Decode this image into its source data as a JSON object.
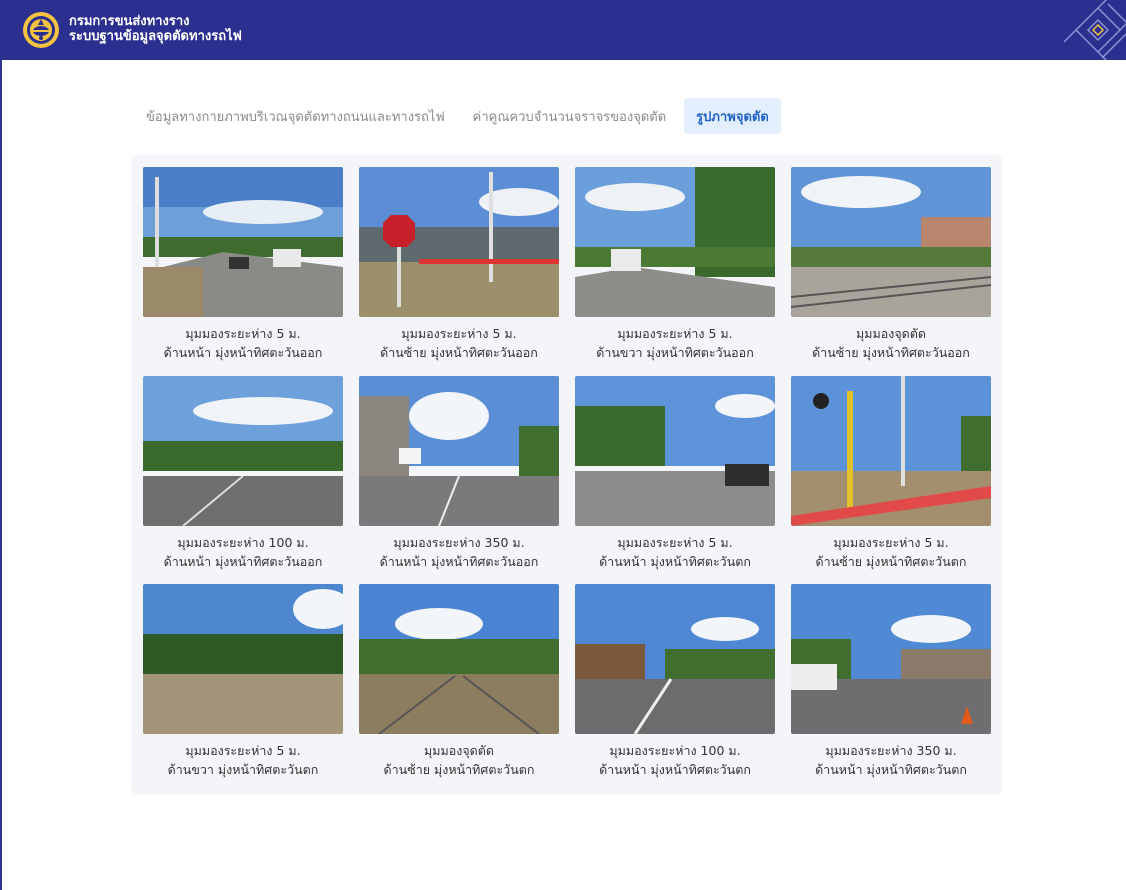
{
  "header": {
    "org_name": "กรมการขนส่งทางราง",
    "system_name": "ระบบฐานข้อมูลจุดตัดทางรถไฟ"
  },
  "tabs": [
    {
      "label": "ข้อมูลทางกายภาพบริเวณจุดตัดทางถนนและทางรถไฟ",
      "active": false
    },
    {
      "label": "ค่าคูณควบจำนวนจราจรของจุดตัด",
      "active": false
    },
    {
      "label": "รูปภาพจุดตัด",
      "active": true
    }
  ],
  "photos": [
    {
      "line1": "มุมมองระยะห่าง 5 ม.",
      "line2": "ด้านหน้า มุ่งหน้าทิศตะวันออก"
    },
    {
      "line1": "มุมมองระยะห่าง 5 ม.",
      "line2": "ด้านซ้าย มุ่งหน้าทิศตะวันออก"
    },
    {
      "line1": "มุมมองระยะห่าง 5 ม.",
      "line2": "ด้านขวา มุ่งหน้าทิศตะวันออก"
    },
    {
      "line1": "มุมมองจุดตัด",
      "line2": "ด้านซ้าย มุ่งหน้าทิศตะวันออก"
    },
    {
      "line1": "มุมมองระยะห่าง 100 ม.",
      "line2": "ด้านหน้า มุ่งหน้าทิศตะวันออก"
    },
    {
      "line1": "มุมมองระยะห่าง 350 ม.",
      "line2": "ด้านหน้า มุ่งหน้าทิศตะวันออก"
    },
    {
      "line1": "มุมมองระยะห่าง 5 ม.",
      "line2": "ด้านหน้า มุ่งหน้าทิศตะวันตก"
    },
    {
      "line1": "มุมมองระยะห่าง 5 ม.",
      "line2": "ด้านซ้าย มุ่งหน้าทิศตะวันตก"
    },
    {
      "line1": "มุมมองระยะห่าง 5 ม.",
      "line2": "ด้านขวา มุ่งหน้าทิศตะวันตก"
    },
    {
      "line1": "มุมมองจุดตัด",
      "line2": "ด้านซ้าย มุ่งหน้าทิศตะวันตก"
    },
    {
      "line1": "มุมมองระยะห่าง 100 ม.",
      "line2": "ด้านหน้า มุ่งหน้าทิศตะวันตก"
    },
    {
      "line1": "มุมมองระยะห่าง 350 ม.",
      "line2": "ด้านหน้า มุ่งหน้าทิศตะวันตก"
    }
  ],
  "colors": {
    "header_bg": "#2b2f8f",
    "active_tab_bg": "#e3effd",
    "active_tab_text": "#2465c4",
    "gallery_bg": "#f4f5f8"
  }
}
